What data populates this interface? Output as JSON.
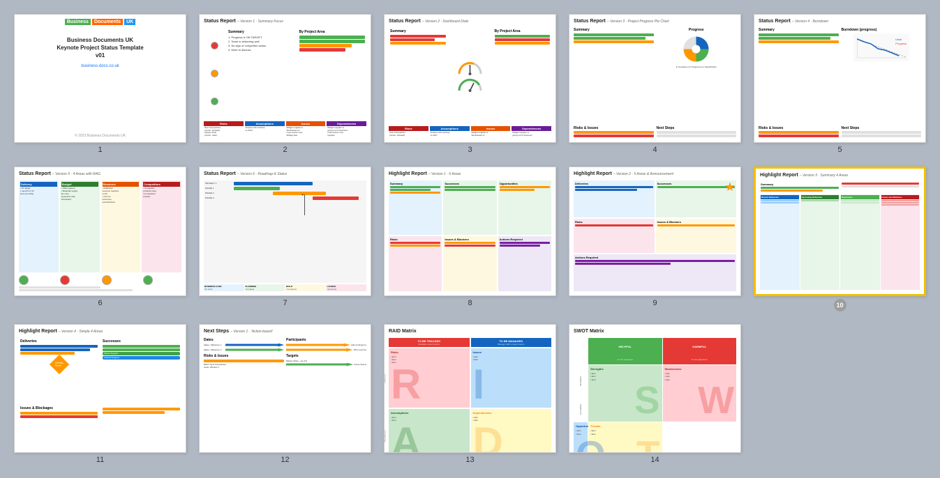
{
  "slides": [
    {
      "id": 1,
      "number": "1",
      "type": "title",
      "logo": {
        "business": "Business",
        "documents": "Documents",
        "uk": "UK"
      },
      "title": "Business Documents UK\nKeynote Project Status Template\nv01",
      "link": "business-docs.co.uk",
      "footer": "© 2023 Business Documents UK"
    },
    {
      "id": 2,
      "number": "2",
      "type": "status-report",
      "title": "Status Report",
      "subtitle": "– Version 1 · Summary Focus"
    },
    {
      "id": 3,
      "number": "3",
      "type": "status-report",
      "title": "Status Report",
      "subtitle": "– Version 2 · Dashboard Dials"
    },
    {
      "id": 4,
      "number": "4",
      "type": "status-report",
      "title": "Status Report",
      "subtitle": "– Version 3 · Project Progress Pie Chart"
    },
    {
      "id": 5,
      "number": "5",
      "type": "status-report",
      "title": "Status Report",
      "subtitle": "– Version 4 · Burndown"
    },
    {
      "id": 6,
      "number": "6",
      "type": "status-report",
      "title": "Status Report",
      "subtitle": "– Version 5 · 4 Areas with RAG"
    },
    {
      "id": 7,
      "number": "7",
      "type": "status-report",
      "title": "Status Report",
      "subtitle": "– Version 6 · Roadmap & Status"
    },
    {
      "id": 8,
      "number": "8",
      "type": "highlight-report",
      "title": "Highlight Report",
      "subtitle": "– Version 1 · 6 Areas"
    },
    {
      "id": 9,
      "number": "9",
      "type": "highlight-report",
      "title": "Highlight Report",
      "subtitle": "– Version 2 · 5 Areas & Announcement"
    },
    {
      "id": 10,
      "number": "10",
      "type": "highlight-report",
      "title": "Highlight Report",
      "subtitle": "– Version 3 · Summary 4 Areas",
      "highlighted": true
    },
    {
      "id": 11,
      "number": "11",
      "type": "highlight-report",
      "title": "Highlight Report",
      "subtitle": "– Version 4 · Simple 4 Areas"
    },
    {
      "id": 12,
      "number": "12",
      "type": "next-steps",
      "title": "Next Steps",
      "subtitle": "– Version 1 · 'Action-based'"
    },
    {
      "id": 13,
      "number": "13",
      "type": "raid-matrix",
      "title": "RAID Matrix",
      "subtitle": ""
    },
    {
      "id": 14,
      "number": "14",
      "type": "swot-matrix",
      "title": "SWOT Matrix",
      "subtitle": ""
    }
  ]
}
